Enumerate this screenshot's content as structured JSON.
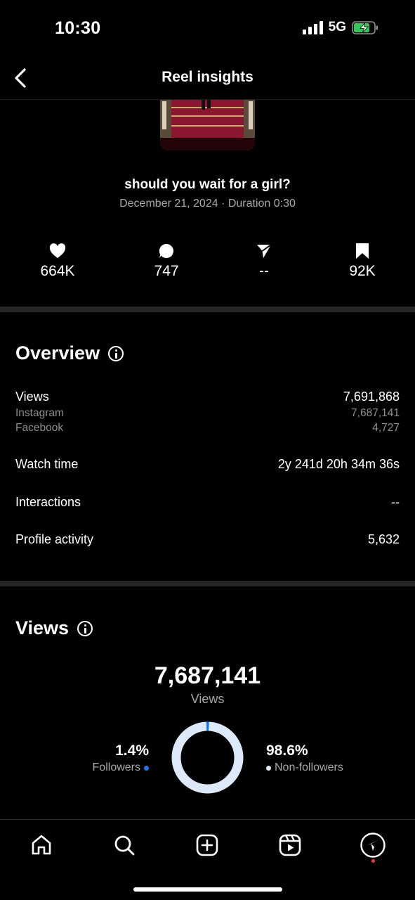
{
  "status": {
    "time": "10:30",
    "network": "5G"
  },
  "nav": {
    "title": "Reel insights",
    "back_icon": "chevron-left-icon"
  },
  "reel": {
    "title": "should you wait for a girl?",
    "meta": "December 21, 2024 · Duration 0:30"
  },
  "stats": {
    "likes": "664K",
    "comments": "747",
    "shares": "--",
    "saves": "92K"
  },
  "overview": {
    "title": "Overview",
    "views_label": "Views",
    "views_value": "7,691,868",
    "instagram_label": "Instagram",
    "instagram_value": "7,687,141",
    "facebook_label": "Facebook",
    "facebook_value": "4,727",
    "watch_time_label": "Watch time",
    "watch_time_value": "2y 241d 20h 34m 36s",
    "interactions_label": "Interactions",
    "interactions_value": "--",
    "profile_activity_label": "Profile activity",
    "profile_activity_value": "5,632"
  },
  "views": {
    "title": "Views",
    "total": "7,687,141",
    "total_label": "Views",
    "followers_pct": "1.4%",
    "followers_label": "Followers",
    "non_followers_pct": "98.6%",
    "non_followers_label": "Non-followers",
    "followers_fraction": 0.014,
    "followers_color": "#1877f2",
    "non_followers_color": "#dce9f8"
  },
  "bottom_nav": [
    "home-icon",
    "search-icon",
    "create-icon",
    "reels-icon",
    "explore-icon"
  ],
  "colors": {
    "notification_dot": "#ff3040",
    "battery_fill": "#34c759"
  }
}
